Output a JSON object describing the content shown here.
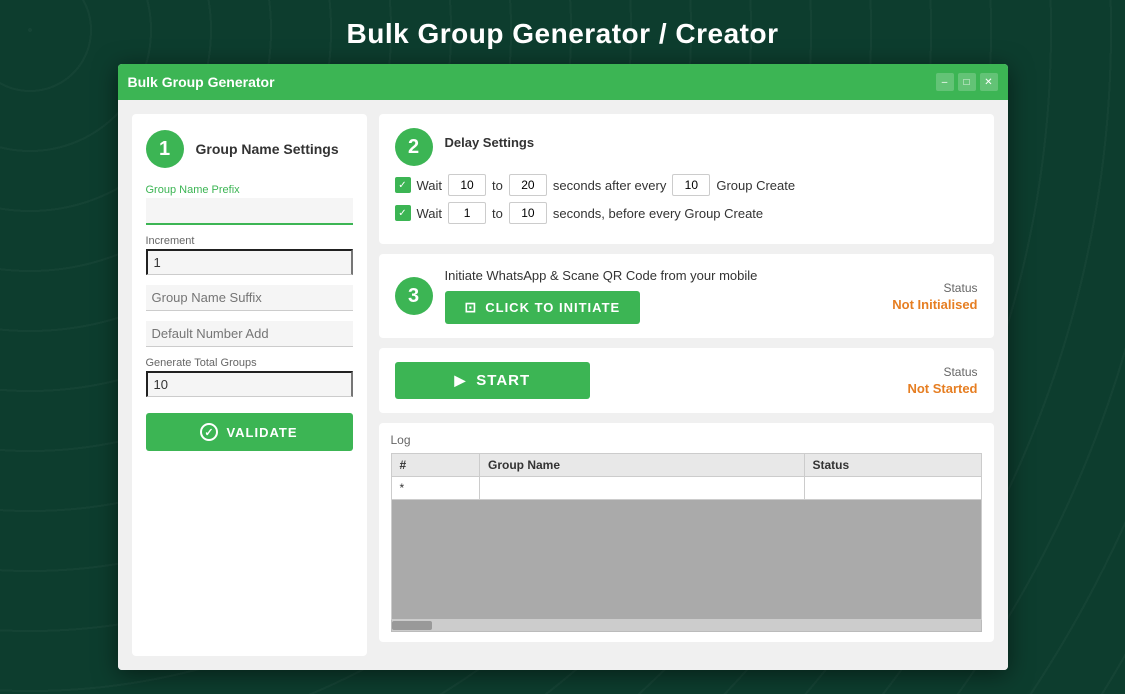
{
  "page": {
    "title": "Bulk Group Generator / Creator"
  },
  "window": {
    "title": "Bulk Group Generator",
    "controls": {
      "minimize": "–",
      "maximize": "□",
      "close": "✕"
    }
  },
  "step1": {
    "number": "1",
    "title": "Group Name Settings",
    "prefix_label": "Group Name Prefix",
    "prefix_value": "",
    "increment_label": "Increment",
    "increment_value": "1",
    "suffix_label": "Group Name Suffix",
    "suffix_placeholder": "Group Name Suffix",
    "default_number_placeholder": "Default Number Add",
    "total_label": "Generate Total Groups",
    "total_value": "10",
    "validate_label": "VALIDATE"
  },
  "step2": {
    "number": "2",
    "title": "Delay Settings",
    "row1": {
      "wait_label": "Wait",
      "from_value": "10",
      "to_label": "to",
      "to_value": "20",
      "seconds_label": "seconds after every",
      "every_value": "10",
      "action_label": "Group Create"
    },
    "row2": {
      "wait_label": "Wait",
      "from_value": "1",
      "to_label": "to",
      "to_value": "10",
      "seconds_label": "seconds, before every Group Create"
    }
  },
  "step3": {
    "number": "3",
    "description": "Initiate WhatsApp & Scane QR Code from your mobile",
    "button_label": "CLICK TO INITIATE",
    "status_label": "Status",
    "status_value": "Not Initialised"
  },
  "start": {
    "button_label": "START",
    "status_label": "Status",
    "status_value": "Not Started"
  },
  "log": {
    "label": "Log",
    "columns": {
      "number": "#",
      "group_name": "Group Name",
      "status": "Status"
    },
    "rows": [
      {
        "number": "*",
        "group_name": "",
        "status": ""
      }
    ]
  }
}
